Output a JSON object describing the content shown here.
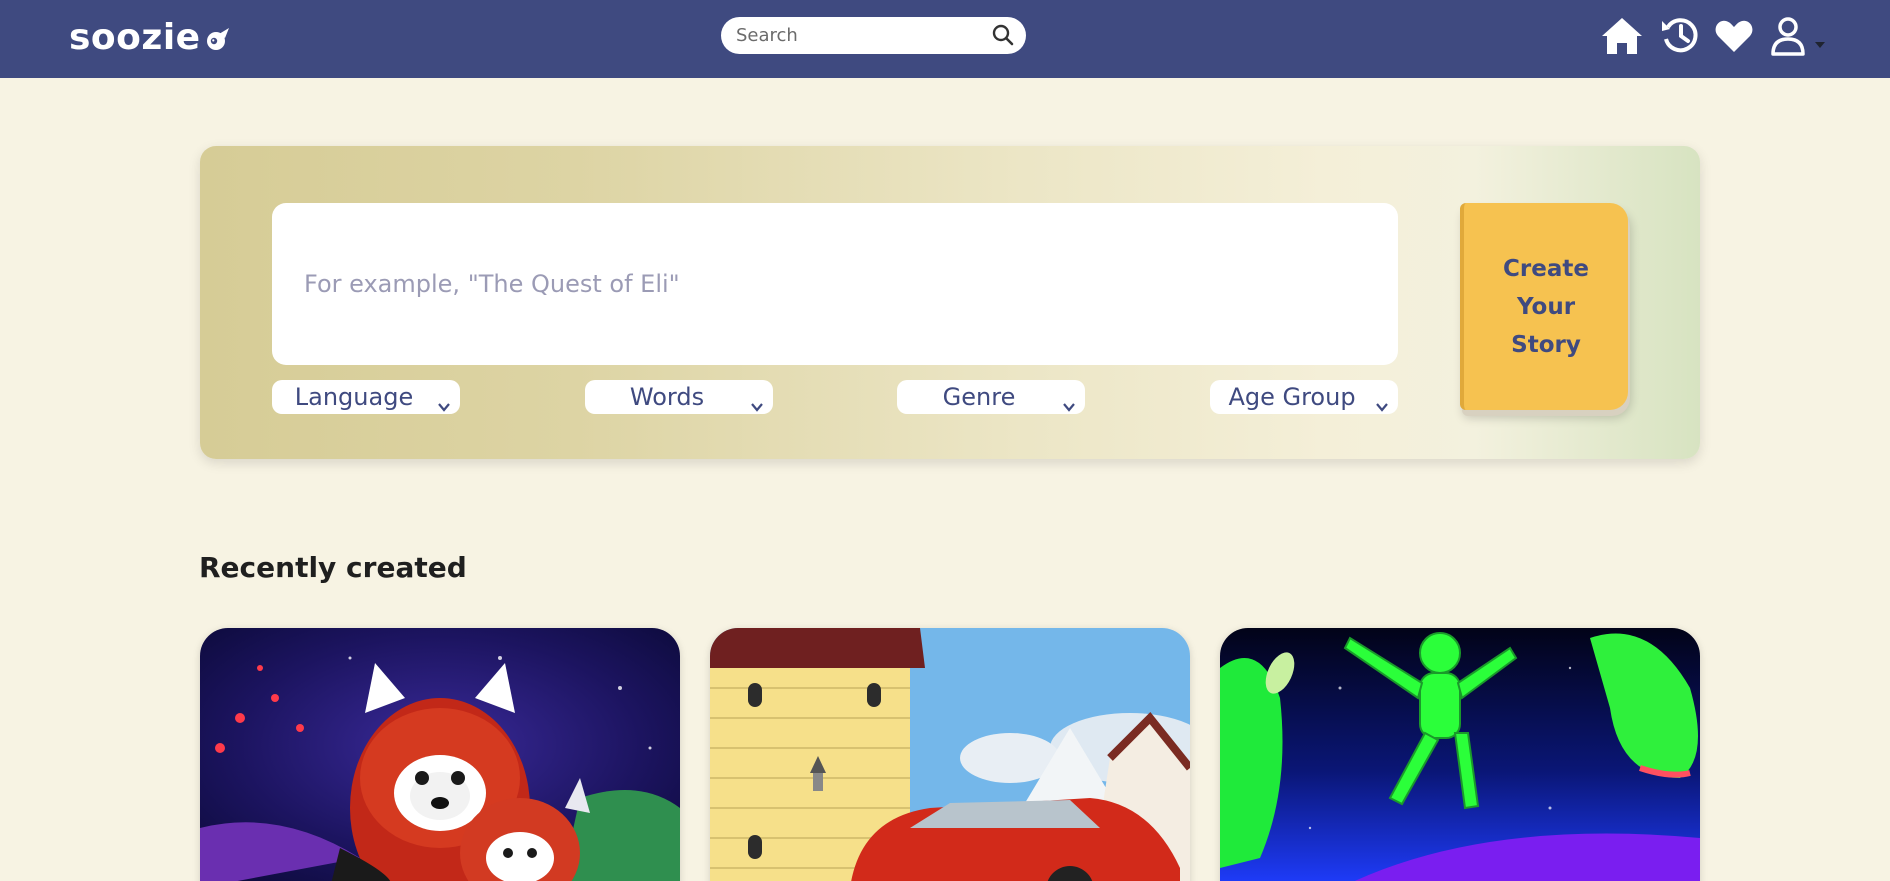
{
  "header": {
    "logo_text": "soozie",
    "search_placeholder": "Search",
    "icons": [
      "home-icon",
      "history-icon",
      "heart-icon",
      "user-icon",
      "caret-down-icon"
    ],
    "bar_color": "#3f4a80"
  },
  "hero": {
    "story_placeholder": "For example, \"The Quest of Eli\"",
    "selects": [
      {
        "label": "Language"
      },
      {
        "label": "Words"
      },
      {
        "label": "Genre"
      },
      {
        "label": "Age Group"
      }
    ],
    "create_button_label": "Create\nYour\nStory",
    "button_color": "#f6c250"
  },
  "recent": {
    "title": "Recently created",
    "cards": [
      {
        "image": "red-pandas-night-sky"
      },
      {
        "image": "red-car-by-yellow-tower"
      },
      {
        "image": "green-figure-in-space"
      }
    ]
  }
}
